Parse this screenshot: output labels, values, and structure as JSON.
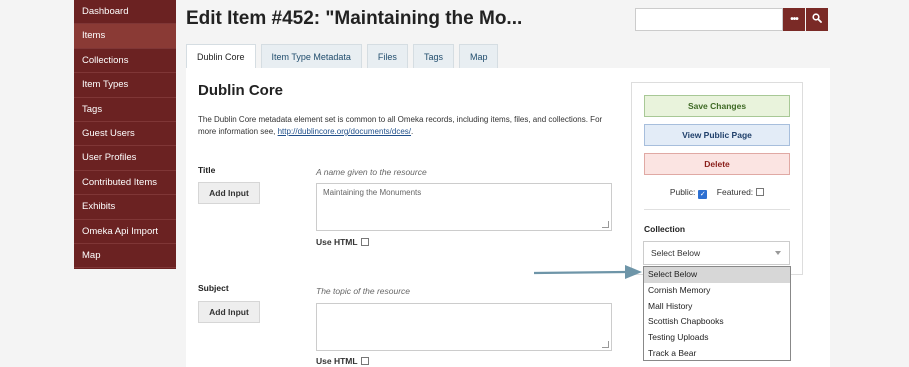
{
  "sidebar": {
    "items": [
      {
        "label": "Dashboard",
        "active": false
      },
      {
        "label": "Items",
        "active": true
      },
      {
        "label": "Collections",
        "active": false
      },
      {
        "label": "Item Types",
        "active": false
      },
      {
        "label": "Tags",
        "active": false
      },
      {
        "label": "Guest Users",
        "active": false
      },
      {
        "label": "User Profiles",
        "active": false
      },
      {
        "label": "Contributed Items",
        "active": false
      },
      {
        "label": "Exhibits",
        "active": false
      },
      {
        "label": "Omeka Api Import",
        "active": false
      },
      {
        "label": "Map",
        "active": false
      }
    ]
  },
  "header": {
    "title": "Edit Item #452: \"Maintaining the Mo...",
    "search_value": "",
    "search_more_glyph": "•••",
    "search_icon": "search-icon"
  },
  "tabs": [
    {
      "label": "Dublin Core",
      "active": true
    },
    {
      "label": "Item Type Metadata",
      "active": false
    },
    {
      "label": "Files",
      "active": false
    },
    {
      "label": "Tags",
      "active": false
    },
    {
      "label": "Map",
      "active": false
    }
  ],
  "main": {
    "section_title": "Dublin Core",
    "description": "The Dublin Core metadata element set is common to all Omeka records, including items, files, and collections. For more information see, ",
    "description_link": "http://dublincore.org/documents/dces/",
    "description_end": ".",
    "fields": [
      {
        "label": "Title",
        "help": "A name given to the resource",
        "button": "Add Input",
        "value": "Maintaining the Monuments",
        "use_html": "Use HTML"
      },
      {
        "label": "Subject",
        "help": "The topic of the resource",
        "button": "Add Input",
        "value": "",
        "use_html": "Use HTML"
      }
    ]
  },
  "actions": {
    "save": "Save Changes",
    "view": "View Public Page",
    "delete": "Delete",
    "public_label": "Public:",
    "public_checked": true,
    "featured_label": "Featured:",
    "featured_checked": false,
    "collection_label": "Collection",
    "collection_selected": "Select Below",
    "collection_options": [
      "Select Below",
      "Cornish Memory",
      "Mall History",
      "Scottish Chapbooks",
      "Testing Uploads",
      "Track a Bear"
    ]
  },
  "colors": {
    "sidebar_bg": "#6b2222",
    "accent": "#7a2a26",
    "annotation_arrow": "#6e95a8"
  }
}
